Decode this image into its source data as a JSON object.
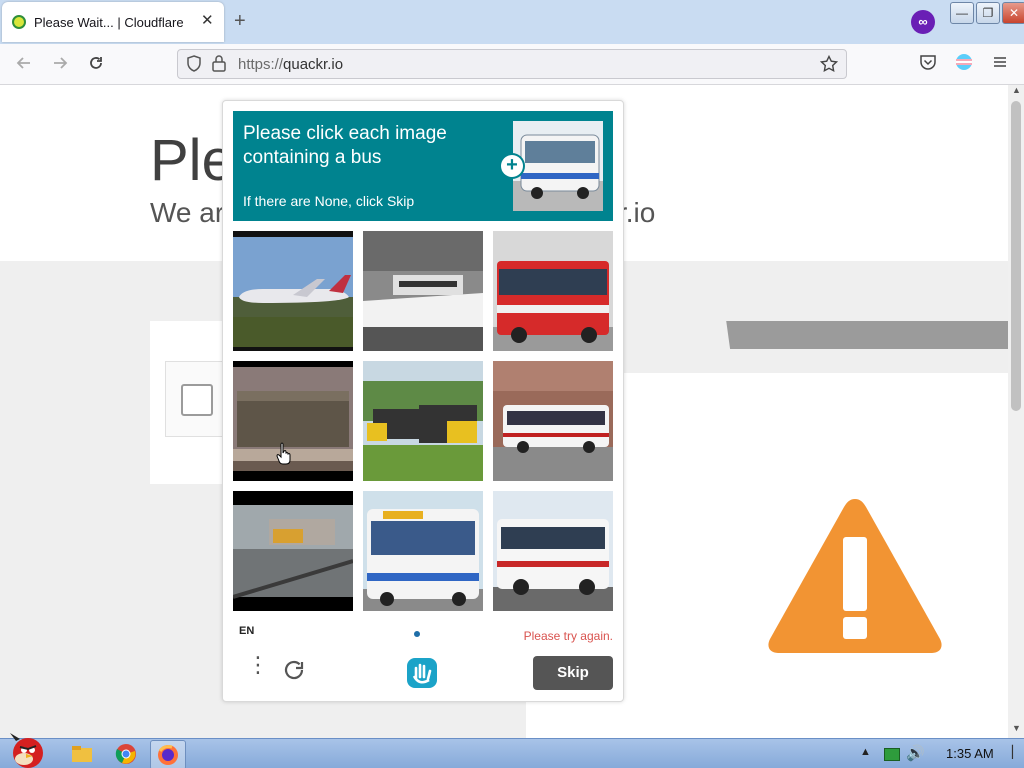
{
  "browser": {
    "tab_title": "Please Wait... | Cloudflare",
    "tab_close": "✕",
    "new_tab": "+",
    "profile_badge": "∞",
    "window_buttons": [
      "—",
      "❐",
      "✕"
    ],
    "url_protocol": "https://",
    "url_host": "quackr.io",
    "icons": [
      "back-icon",
      "forward-icon",
      "reload-icon",
      "shield-icon",
      "lock-icon",
      "star-icon",
      "pocket-icon",
      "extension-icon",
      "menu-icon"
    ]
  },
  "page": {
    "title_partial": "Ple",
    "subtitle_partial_left": "We ar",
    "subtitle_partial_right": "kr.io"
  },
  "captcha": {
    "prompt": "Please click each image containing a bus",
    "skip_hint": "If there are None, click Skip",
    "language": "EN",
    "error": "Please try again.",
    "skip_label": "Skip",
    "target_object": "bus",
    "tiles": [
      {
        "content": "airplane"
      },
      {
        "content": "boat"
      },
      {
        "content": "bus"
      },
      {
        "content": "train"
      },
      {
        "content": "train"
      },
      {
        "content": "bus"
      },
      {
        "content": "train"
      },
      {
        "content": "bus"
      },
      {
        "content": "bus"
      }
    ],
    "colors": {
      "header": "#00838f",
      "error": "#d9534f",
      "skip_button": "#555555"
    }
  },
  "taskbar": {
    "clock": "1:35 AM",
    "tray_arrow": "▲",
    "volume": "🔊"
  },
  "warning_color": "#f29433"
}
